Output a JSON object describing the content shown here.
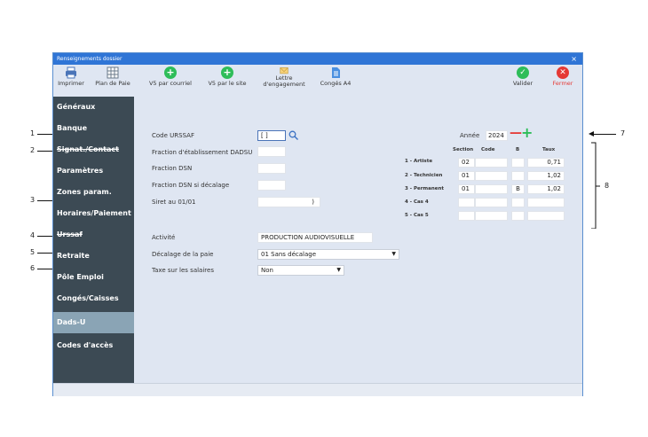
{
  "window": {
    "title": "Renseignements dossier",
    "close_glyph": "×"
  },
  "toolbar": [
    {
      "id": "imprimer",
      "label": "Imprimer",
      "icon": "printer-icon"
    },
    {
      "id": "plan",
      "label": "Plan de Paie",
      "icon": "grid-icon"
    },
    {
      "id": "v5courriel",
      "label": "V5 par courriel",
      "icon": "add-circle-icon"
    },
    {
      "id": "v5site",
      "label": "V5 par le site",
      "icon": "add-circle-icon"
    },
    {
      "id": "lettre",
      "label_top": "Lettre",
      "label_bottom": "d'engagement",
      "icon": "envelope-icon"
    },
    {
      "id": "conges",
      "label": "Congés A4",
      "icon": "document-icon"
    },
    {
      "id": "valider",
      "label": "Valider",
      "icon": "check-circle-icon"
    },
    {
      "id": "fermer",
      "label": "Fermer",
      "icon": "close-circle-icon"
    }
  ],
  "sidebar": {
    "items": [
      {
        "label": "Généraux"
      },
      {
        "label": "Banque"
      },
      {
        "label": "Signat./Contact"
      },
      {
        "label": "Paramètres"
      },
      {
        "label": "Zones param."
      },
      {
        "label": "Horaires/Paiement"
      },
      {
        "label": "Urssaf"
      },
      {
        "label": "Retraite"
      },
      {
        "label": "Pôle Emploi"
      },
      {
        "label": "Congés/Caisses"
      },
      {
        "label": "Dads-U",
        "active": true
      },
      {
        "label": "Codes d'accès"
      }
    ]
  },
  "form": {
    "code_urssaf_label": "Code URSSAF",
    "code_urssaf_value": "[ ]",
    "fraction_etab_label": "Fraction d'établissement DADSU",
    "fraction_dsn_label": "Fraction DSN",
    "fraction_dsn_decalage_label": "Fraction DSN si décalage",
    "siret_label": "Siret au 01/01",
    "siret_value": ")",
    "activite_label": "Activité",
    "activite_value": "PRODUCTION AUDIOVISUELLE",
    "decalage_label": "Décalage de la paie",
    "decalage_value": "01 Sans décalage",
    "taxe_label": "Taxe sur les salaires",
    "taxe_value": "Non"
  },
  "annee": {
    "label": "Année",
    "value": "2024",
    "minus": "—",
    "plus": "+"
  },
  "table": {
    "headers": {
      "section": "Section",
      "code": "Code",
      "b": "B",
      "taux": "Taux"
    },
    "rows": [
      {
        "label": "1 - Artiste",
        "section": "02",
        "code": "",
        "b": "",
        "taux": "0,71"
      },
      {
        "label": "2 - Technicien",
        "section": "01",
        "code": "",
        "b": "",
        "taux": "1,02"
      },
      {
        "label": "3 - Permanent",
        "section": "01",
        "code": "",
        "b": "B",
        "taux": "1,02"
      },
      {
        "label": "4 - Cas 4",
        "section": "",
        "code": "",
        "b": "",
        "taux": ""
      },
      {
        "label": "5 - Cas 5",
        "section": "",
        "code": "",
        "b": "",
        "taux": ""
      }
    ]
  },
  "callouts": [
    "1",
    "2",
    "3",
    "4",
    "5",
    "6",
    "7",
    "8"
  ],
  "colors": {
    "titlebar": "#2f75d6",
    "sidebar": "#3c4a54",
    "sidebar_active": "#8aa4b5",
    "green": "#2ebd59",
    "red": "#e53935"
  }
}
